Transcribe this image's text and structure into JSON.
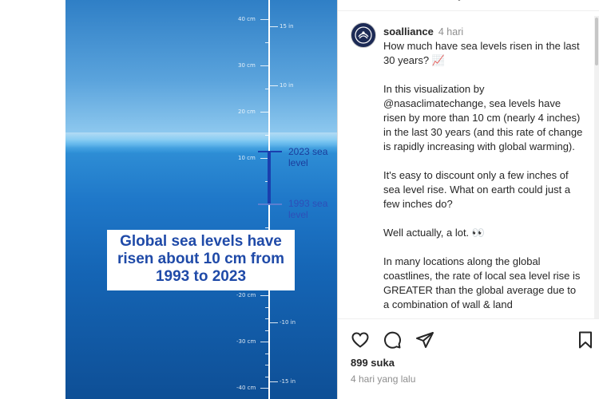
{
  "media": {
    "ruler_cm": [
      "40 cm",
      "30 cm",
      "20 cm",
      "10 cm",
      "-20 cm",
      "-30 cm",
      "-40 cm"
    ],
    "ruler_in": [
      "15 in",
      "10 in",
      "-10 in",
      "-15 in"
    ],
    "sea_level_2023": "2023 sea level",
    "sea_level_1993": "1993 sea level",
    "caption_lines": [
      "Global sea levels have",
      "risen about 10 cm from",
      "1993 to 2023"
    ],
    "colors": {
      "mark_2023": "#1a3fae",
      "mark_1993": "#5c7fd0",
      "caption_text": "#1f4aa8"
    }
  },
  "post": {
    "username": "soalliance",
    "time": "4 hari",
    "paragraphs": [
      "How much have sea levels risen in the last 30 years? 📈",
      "In this visualization by @nasaclimatechange, sea levels have risen by more than 10 cm (nearly 4 inches) in the last 30 years (and this rate of change is rapidly increasing with global warming).",
      "It's easy to discount only a few inches of sea level rise. What on earth could just a few inches do?",
      "Well actually, a lot. 👀",
      "In many locations along the global coastlines, the rate of local sea level rise is GREATER than the global average due to a combination of wall & land"
    ],
    "likes": "899 suka",
    "timestamp": "4 hari yang lalu",
    "icons": [
      "heart-icon",
      "comment-icon",
      "share-icon",
      "bookmark-icon"
    ]
  }
}
